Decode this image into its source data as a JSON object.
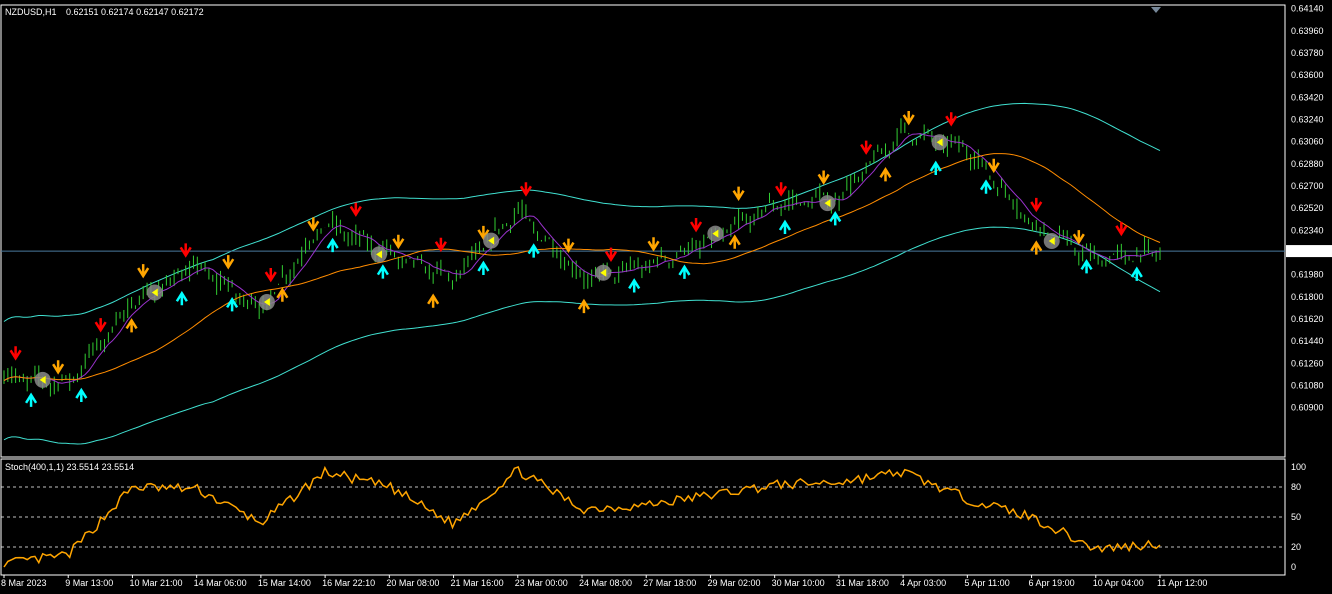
{
  "header": {
    "symbol": "NZDUSD,H1",
    "ohlc": "0.62151 0.62174 0.62147 0.62172"
  },
  "indicator": {
    "label": "Stoch(400,1,1) 23.5514 23.5514"
  },
  "colors": {
    "background": "#000000",
    "frame": "#ffffff",
    "candles": "#32cd32",
    "bollinger": "#40e0d0",
    "ma_slow": "#ff8c00",
    "ma_fast": "#9932cc",
    "stoch": "#ffa500",
    "bid_line": "#4a7a9e",
    "arrow_red": "#ff0000",
    "arrow_orange": "#ffa500",
    "arrow_cyan": "#00ffff",
    "arrow_yellow": "#ffff00"
  },
  "chart_data": [
    {
      "type": "line",
      "subtype": "candlestick-price",
      "symbol": "NZDUSD",
      "timeframe": "H1",
      "x": [
        "8 Mar 2023",
        "9 Mar 13:00",
        "10 Mar 21:00",
        "14 Mar 06:00",
        "15 Mar 14:00",
        "16 Mar 22:10",
        "20 Mar 08:00",
        "21 Mar 16:00",
        "23 Mar 00:00",
        "24 Mar 08:00",
        "27 Mar 18:00",
        "29 Mar 02:00",
        "30 Mar 10:00",
        "31 Mar 18:00",
        "4 Apr 03:00",
        "5 Apr 11:00",
        "6 Apr 19:00",
        "10 Apr 04:00",
        "11 Apr 12:00"
      ],
      "series": [
        {
          "values": [
            0.6115,
            0.611,
            0.6175,
            0.6205,
            0.617,
            0.624,
            0.6215,
            0.6195,
            0.625,
            0.6195,
            0.6205,
            0.6225,
            0.6255,
            0.626,
            0.6315,
            0.63,
            0.624,
            0.621,
            0.6217
          ]
        }
      ],
      "ylim": [
        0.605,
        0.6417
      ],
      "yticks": [
        "0.64140",
        "0.63960",
        "0.63780",
        "0.63600",
        "0.63420",
        "0.63240",
        "0.63060",
        "0.62880",
        "0.62700",
        "0.62520",
        "0.62340",
        "0.62172",
        "0.62160",
        "0.61980",
        "0.61800",
        "0.61620",
        "0.61440",
        "0.61260",
        "0.61080",
        "0.60900"
      ],
      "current_price": "0.62172"
    },
    {
      "type": "line",
      "subtype": "stochastic",
      "x": [
        "8 Mar 2023",
        "9 Mar 13:00",
        "10 Mar 21:00",
        "14 Mar 06:00",
        "15 Mar 14:00",
        "16 Mar 22:10",
        "20 Mar 08:00",
        "21 Mar 16:00",
        "23 Mar 00:00",
        "24 Mar 08:00",
        "27 Mar 18:00",
        "29 Mar 02:00",
        "30 Mar 10:00",
        "31 Mar 18:00",
        "4 Apr 03:00",
        "5 Apr 11:00",
        "6 Apr 19:00",
        "10 Apr 04:00",
        "11 Apr 12:00"
      ],
      "series": [
        {
          "values": [
            3,
            12,
            80,
            78,
            44,
            95,
            80,
            43,
            97,
            58,
            62,
            72,
            82,
            85,
            95,
            68,
            50,
            18,
            23.5514
          ]
        }
      ],
      "ylim": [
        0,
        100
      ],
      "yticks": [
        "100",
        "80",
        "50",
        "20",
        "0"
      ],
      "levels": [
        80,
        50,
        20
      ]
    }
  ]
}
